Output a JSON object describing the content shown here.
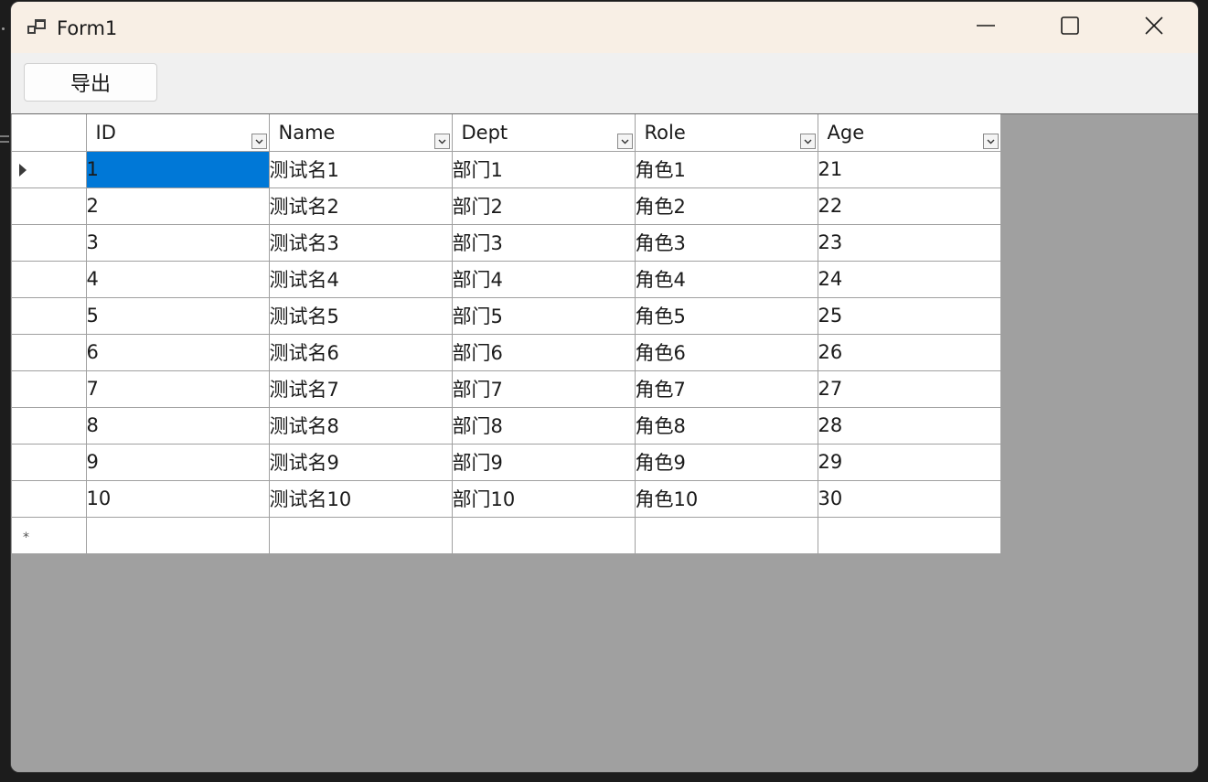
{
  "window": {
    "title": "Form1"
  },
  "toolbar": {
    "export_label": "导出"
  },
  "grid": {
    "columns": [
      "ID",
      "Name",
      "Dept",
      "Role",
      "Age"
    ],
    "rows": [
      [
        "1",
        "测试名1",
        "部门1",
        "角色1",
        "21"
      ],
      [
        "2",
        "测试名2",
        "部门2",
        "角色2",
        "22"
      ],
      [
        "3",
        "测试名3",
        "部门3",
        "角色3",
        "23"
      ],
      [
        "4",
        "测试名4",
        "部门4",
        "角色4",
        "24"
      ],
      [
        "5",
        "测试名5",
        "部门5",
        "角色5",
        "25"
      ],
      [
        "6",
        "测试名6",
        "部门6",
        "角色6",
        "26"
      ],
      [
        "7",
        "测试名7",
        "部门7",
        "角色7",
        "27"
      ],
      [
        "8",
        "测试名8",
        "部门8",
        "角色8",
        "28"
      ],
      [
        "9",
        "测试名9",
        "部门9",
        "角色9",
        "29"
      ],
      [
        "10",
        "测试名10",
        "部门10",
        "角色10",
        "30"
      ]
    ],
    "selected_row": 0,
    "selected_column": 0,
    "new_row_marker": "*"
  },
  "colors": {
    "titlebar": "#f8efe5",
    "selection": "#0078d7",
    "grid_background": "#a0a0a0"
  },
  "icons": {
    "app": "app-window-icon",
    "minimize": "minimize-icon",
    "maximize": "maximize-icon",
    "close": "close-icon",
    "filter": "filter-dropdown-icon",
    "current_row": "current-row-arrow-icon"
  }
}
